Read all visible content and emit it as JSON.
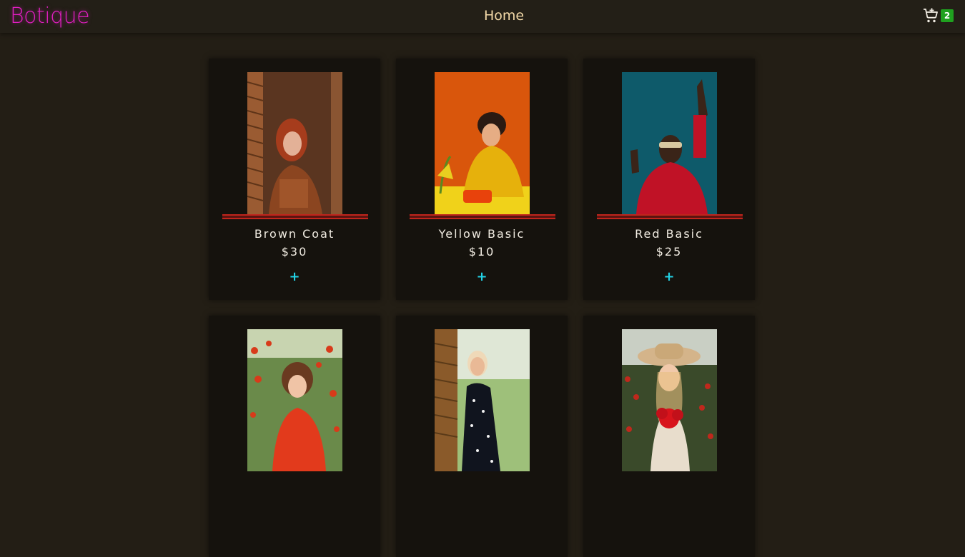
{
  "nav": {
    "brand": "Botique",
    "home": "Home",
    "cart_icon": "cart-icon",
    "cart_count": "2"
  },
  "colors": {
    "background": "#231e15",
    "brand": "#e01ec0",
    "nav_link": "#f3d9a8",
    "badge": "#1fa11f",
    "accent_line": "#c0251c",
    "add_button": "#22d3e6"
  },
  "products": [
    {
      "name": "Brown Coat",
      "price": "$30",
      "add_label": "+"
    },
    {
      "name": "Yellow Basic",
      "price": "$10",
      "add_label": "+"
    },
    {
      "name": "Red Basic",
      "price": "$25",
      "add_label": "+"
    },
    {
      "name": "",
      "price": "",
      "add_label": ""
    },
    {
      "name": "",
      "price": "",
      "add_label": ""
    },
    {
      "name": "",
      "price": "",
      "add_label": ""
    }
  ]
}
